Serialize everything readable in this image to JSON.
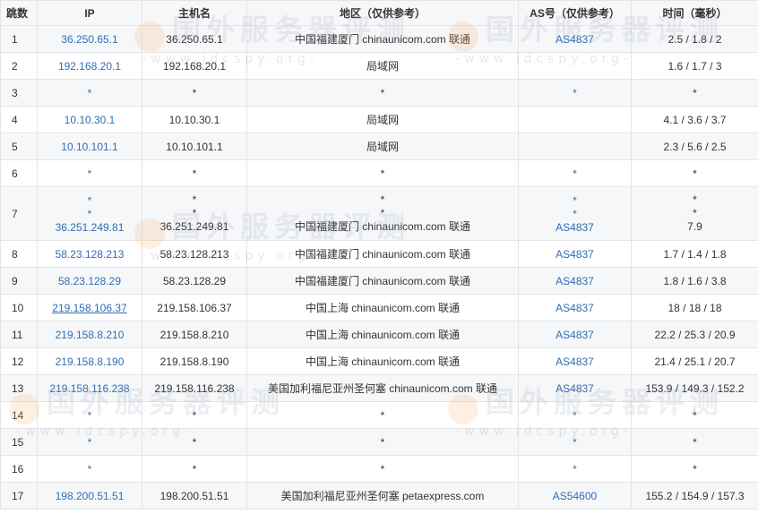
{
  "headers": {
    "hop": "跳数",
    "ip": "IP",
    "hostname": "主机名",
    "location": "地区（仅供参考）",
    "as": "AS号（仅供参考）",
    "time": "时间（毫秒）"
  },
  "rows": [
    {
      "hop": "1",
      "ip": "36.250.65.1",
      "host": "36.250.65.1",
      "loc": "中国福建厦门 chinaunicom.com 联通",
      "asn": "AS4837",
      "time": "2.5 / 1.8 / 2"
    },
    {
      "hop": "2",
      "ip": "192.168.20.1",
      "host": "192.168.20.1",
      "loc": "局域网",
      "asn": "",
      "time": "1.6 / 1.7 / 3"
    },
    {
      "hop": "3",
      "ip": "*",
      "host": "*",
      "loc": "*",
      "asn": "*",
      "time": "*"
    },
    {
      "hop": "4",
      "ip": "10.10.30.1",
      "host": "10.10.30.1",
      "loc": "局域网",
      "asn": "",
      "time": "4.1 / 3.6 / 3.7"
    },
    {
      "hop": "5",
      "ip": "10.10.101.1",
      "host": "10.10.101.1",
      "loc": "局域网",
      "asn": "",
      "time": "2.3 / 5.6 / 2.5"
    },
    {
      "hop": "6",
      "ip": "*",
      "host": "*",
      "loc": "*",
      "asn": "*",
      "time": "*"
    },
    {
      "hop": "7",
      "ip": [
        "*",
        "*",
        "36.251.249.81"
      ],
      "host": [
        "*",
        "*",
        "36.251.249.81"
      ],
      "loc": [
        "*",
        "*",
        "中国福建厦门 chinaunicom.com 联通"
      ],
      "asn": [
        "*",
        "*",
        "AS4837"
      ],
      "time": [
        "*",
        "*",
        "7.9"
      ]
    },
    {
      "hop": "8",
      "ip": "58.23.128.213",
      "host": "58.23.128.213",
      "loc": "中国福建厦门 chinaunicom.com 联通",
      "asn": "AS4837",
      "time": "1.7 / 1.4 / 1.8"
    },
    {
      "hop": "9",
      "ip": "58.23.128.29",
      "host": "58.23.128.29",
      "loc": "中国福建厦门 chinaunicom.com 联通",
      "asn": "AS4837",
      "time": "1.8 / 1.6 / 3.8"
    },
    {
      "hop": "10",
      "ip": "219.158.106.37",
      "host": "219.158.106.37",
      "loc": "中国上海 chinaunicom.com 联通",
      "asn": "AS4837",
      "time": "18 / 18 / 18"
    },
    {
      "hop": "11",
      "ip": "219.158.8.210",
      "host": "219.158.8.210",
      "loc": "中国上海 chinaunicom.com 联通",
      "asn": "AS4837",
      "time": "22.2 / 25.3 / 20.9"
    },
    {
      "hop": "12",
      "ip": "219.158.8.190",
      "host": "219.158.8.190",
      "loc": "中国上海 chinaunicom.com 联通",
      "asn": "AS4837",
      "time": "21.4 / 25.1 / 20.7"
    },
    {
      "hop": "13",
      "ip": "219.158.116.238",
      "host": "219.158.116.238",
      "loc": "美国加利福尼亚州圣何塞 chinaunicom.com 联通",
      "asn": "AS4837",
      "time": "153.9 / 149.3 / 152.2"
    },
    {
      "hop": "14",
      "ip": "*",
      "host": "*",
      "loc": "*",
      "asn": "*",
      "time": "*"
    },
    {
      "hop": "15",
      "ip": "*",
      "host": "*",
      "loc": "*",
      "asn": "*",
      "time": "*"
    },
    {
      "hop": "16",
      "ip": "*",
      "host": "*",
      "loc": "*",
      "asn": "*",
      "time": "*"
    },
    {
      "hop": "17",
      "ip": "198.200.51.51",
      "host": "198.200.51.51",
      "loc": "美国加利福尼亚州圣何塞 petaexpress.com",
      "asn": "AS54600",
      "time": "155.2 / 154.9 / 157.3"
    }
  ],
  "watermark": {
    "text": "国外服务器评测",
    "url": "-www.idcspy.org-"
  },
  "colors": {
    "link": "#2f6eb5",
    "header_bg": "#f6f7f9",
    "alt_row_bg": "#f5f7f9",
    "border": "#e4e4e4"
  }
}
